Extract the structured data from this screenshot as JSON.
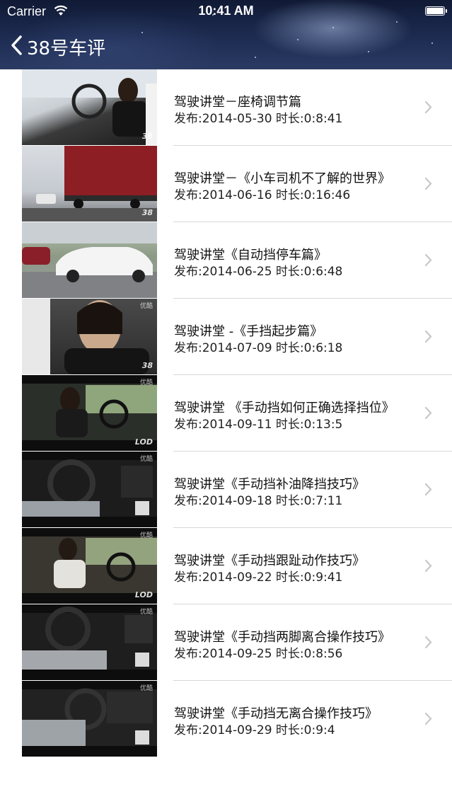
{
  "status_bar": {
    "carrier": "Carrier",
    "time": "10:41 AM"
  },
  "nav": {
    "title": "38号车评"
  },
  "videos": [
    {
      "title": "驾驶讲堂－座椅调节篇",
      "meta": "发布:2014-05-30 时长:0:8:41",
      "badge": "38",
      "watermark": ""
    },
    {
      "title": "驾驶讲堂－《小车司机不了解的世界》",
      "meta": "发布:2014-06-16 时长:0:16:46",
      "badge": "38",
      "watermark": ""
    },
    {
      "title": "驾驶讲堂《自动挡停车篇》",
      "meta": "发布:2014-06-25 时长:0:6:48",
      "badge": "",
      "watermark": ""
    },
    {
      "title": "驾驶讲堂 -《手挡起步篇》",
      "meta": "发布:2014-07-09 时长:0:6:18",
      "badge": "38",
      "watermark": "优酷"
    },
    {
      "title": "驾驶讲堂 《手动挡如何正确选择挡位》",
      "meta": "发布:2014-09-11 时长:0:13:5",
      "badge": "LOD",
      "watermark": "优酷"
    },
    {
      "title": "驾驶讲堂《手动挡补油降挡技巧》",
      "meta": "发布:2014-09-18 时长:0:7:11",
      "badge": "",
      "watermark": "优酷"
    },
    {
      "title": "驾驶讲堂《手动挡跟趾动作技巧》",
      "meta": "发布:2014-09-22 时长:0:9:41",
      "badge": "LOD",
      "watermark": "优酷"
    },
    {
      "title": "驾驶讲堂《手动挡两脚离合操作技巧》",
      "meta": "发布:2014-09-25 时长:0:8:56",
      "badge": "",
      "watermark": "优酷"
    },
    {
      "title": "驾驶讲堂《手动挡无离合操作技巧》",
      "meta": "发布:2014-09-29 时长:0:9:4",
      "badge": "",
      "watermark": "优酷"
    }
  ],
  "colors": {
    "separator": "#d8d8dc",
    "chevron": "#c7c7cc",
    "text": "#111111"
  }
}
